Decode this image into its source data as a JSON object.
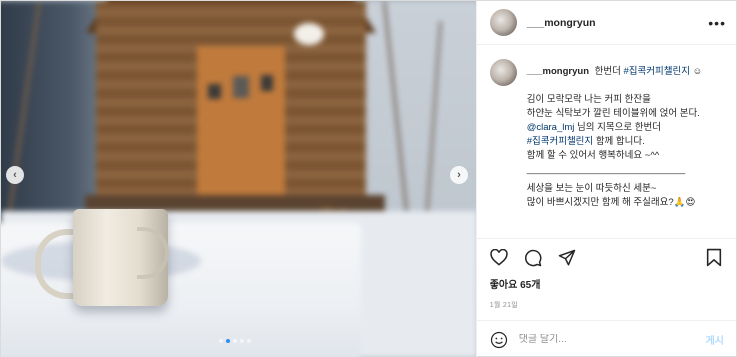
{
  "post": {
    "username": "___mongryun",
    "caption": {
      "inline_text": "한번더",
      "hashtag_1": "#집콕커피챌린지",
      "emoji_1": "☺",
      "line_1": "김이 모락모락 나는 커피 한잔을",
      "line_2": "하얀눈 식탁보가 깔린 테이블위에 얹어 본다.",
      "mention": "@clara_lmj",
      "line_3_rest": "님의 지목으로 한번더",
      "hashtag_2": "#집콕커피챌린지",
      "line_4_rest": "함께 합니다.",
      "line_5": "함께 할 수 있어서 행복하네요 ~^^",
      "divider": "______________________________",
      "line_6": "세상을 보는 눈이 따듯하신 세분~",
      "line_7": "많이 바쁘시겠지만 함께 해 주실래요?🙏😍"
    },
    "likes": "좋아요 65개",
    "date": "1월 21일",
    "comment_placeholder": "댓글 달기...",
    "post_button": "게시"
  },
  "carousel": {
    "slide_count": 5,
    "active_index": 1,
    "prev_label": "‹",
    "next_label": "›"
  },
  "icons": {
    "more": "more-options-icon",
    "heart": "heart-icon",
    "comment": "comment-icon",
    "share": "share-icon",
    "save": "bookmark-icon",
    "emoji": "emoji-icon"
  },
  "colors": {
    "link": "#00376b",
    "active_dot": "#2b8ff0",
    "post_button": "#b3dbff"
  }
}
